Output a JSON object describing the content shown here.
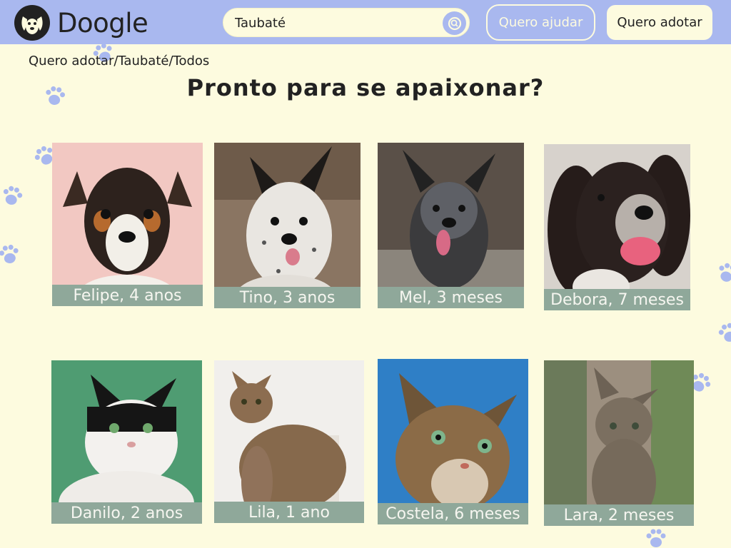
{
  "header": {
    "logo_text": "Doogle",
    "search": {
      "value": "Taubaté",
      "placeholder": ""
    },
    "help_button": "Quero ajudar",
    "adopt_button": "Quero adotar"
  },
  "breadcrumb": "Quero adotar/Taubaté/Todos",
  "title": "Pronto para se apaixonar?",
  "colors": {
    "header": "#a9b8ef",
    "background": "#fdfbdf",
    "label_bg": "#8fa89a",
    "paw": "#a9b8ef"
  },
  "pets": [
    {
      "label": "Felipe, 4 anos",
      "species": "dog"
    },
    {
      "label": "Tino, 3 anos",
      "species": "dog"
    },
    {
      "label": "Mel, 3 meses",
      "species": "dog"
    },
    {
      "label": "Debora, 7 meses",
      "species": "dog"
    },
    {
      "label": "Danilo, 2 anos",
      "species": "cat"
    },
    {
      "label": "Lila, 1 ano",
      "species": "cat"
    },
    {
      "label": "Costela, 6 meses",
      "species": "cat"
    },
    {
      "label": "Lara, 2 meses",
      "species": "cat"
    }
  ]
}
